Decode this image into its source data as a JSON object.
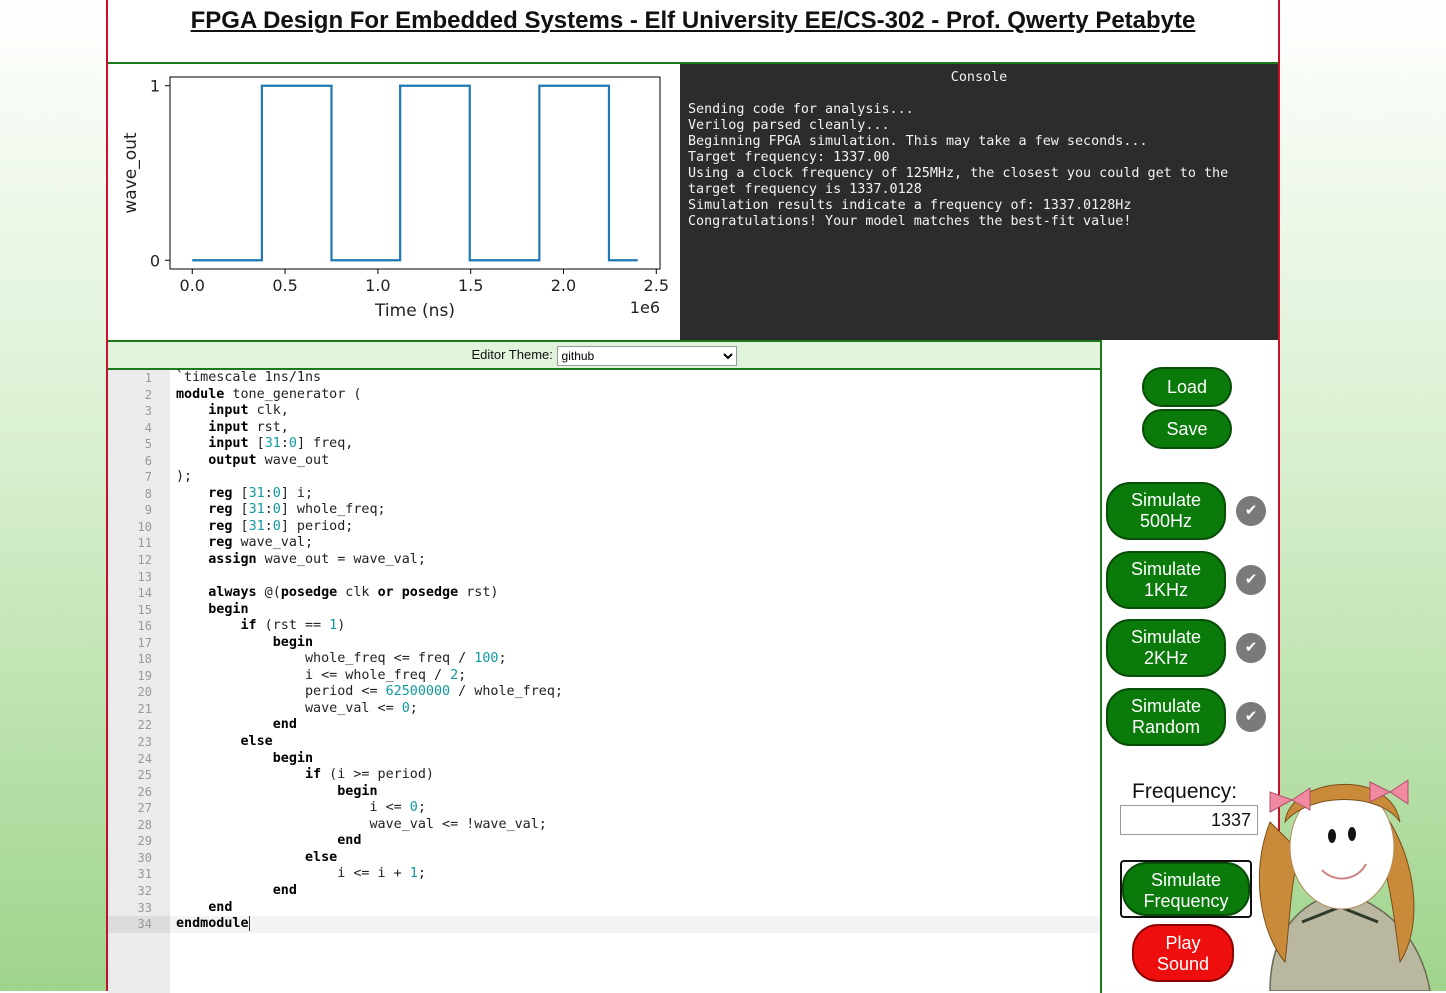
{
  "header": {
    "title": "FPGA Design For Embedded Systems - Elf University EE/CS-302 - Prof. Qwerty Petabyte"
  },
  "chart_data": {
    "type": "line",
    "xlabel": "Time (ns)",
    "ylabel": "wave_out",
    "x_multiplier_label": "1e6",
    "x_ticks": [
      "0.0",
      "0.5",
      "1.0",
      "1.5",
      "2.0",
      "2.5"
    ],
    "y_ticks": [
      "0",
      "1"
    ],
    "xlim": [
      -0.12,
      2.52
    ],
    "ylim": [
      -0.05,
      1.05
    ],
    "series": [
      {
        "color": "#1f77b4",
        "x": [
          0.0,
          0.375,
          0.375,
          0.75,
          0.75,
          1.12,
          1.12,
          1.495,
          1.495,
          1.87,
          1.87,
          2.245,
          2.245,
          2.4
        ],
        "y": [
          0,
          0,
          1,
          1,
          0,
          0,
          1,
          1,
          0,
          0,
          1,
          1,
          0,
          0
        ]
      }
    ]
  },
  "console": {
    "title": "Console",
    "lines": [
      "Sending code for analysis...",
      "Verilog parsed cleanly...",
      "Beginning FPGA simulation. This may take a few seconds...",
      "Target frequency: 1337.00",
      "Using a clock frequency of 125MHz, the closest you could get to the target frequency is 1337.0128",
      "Simulation results indicate a frequency of: 1337.0128Hz",
      "Congratulations! Your model matches the best-fit value!"
    ]
  },
  "editor": {
    "theme_label": "Editor Theme:",
    "theme_value": "github",
    "current_line": 34,
    "lines": [
      "`timescale 1ns/1ns",
      "module tone_generator (",
      "    input clk,",
      "    input rst,",
      "    input [31:0] freq,",
      "    output wave_out",
      ");",
      "    reg [31:0] i;",
      "    reg [31:0] whole_freq;",
      "    reg [31:0] period;",
      "    reg wave_val;",
      "    assign wave_out = wave_val;",
      "",
      "    always @(posedge clk or posedge rst)",
      "    begin",
      "        if (rst == 1)",
      "            begin",
      "                whole_freq <= freq / 100;",
      "                i <= whole_freq / 2;",
      "                period <= 62500000 / whole_freq;",
      "                wave_val <= 0;",
      "            end",
      "        else",
      "            begin",
      "                if (i >= period)",
      "                    begin",
      "                        i <= 0;",
      "                        wave_val <= !wave_val;",
      "                    end",
      "                else",
      "                    i <= i + 1;",
      "            end",
      "    end",
      "endmodule"
    ]
  },
  "sidebar": {
    "load": "Load",
    "save": "Save",
    "sim_buttons": [
      {
        "line1": "Simulate",
        "line2": "500Hz"
      },
      {
        "line1": "Simulate",
        "line2": "1KHz"
      },
      {
        "line1": "Simulate",
        "line2": "2KHz"
      },
      {
        "line1": "Simulate",
        "line2": "Random"
      }
    ],
    "frequency_label": "Frequency:",
    "frequency_value": "1337",
    "simulate_frequency": {
      "line1": "Simulate",
      "line2": "Frequency"
    },
    "play_sound": {
      "line1": "Play",
      "line2": "Sound"
    }
  },
  "colors": {
    "accent_green": "#0a7a0a",
    "frame_red": "#c8102e",
    "console_bg": "#2b2d2b",
    "play_red": "#ee0e0e"
  }
}
